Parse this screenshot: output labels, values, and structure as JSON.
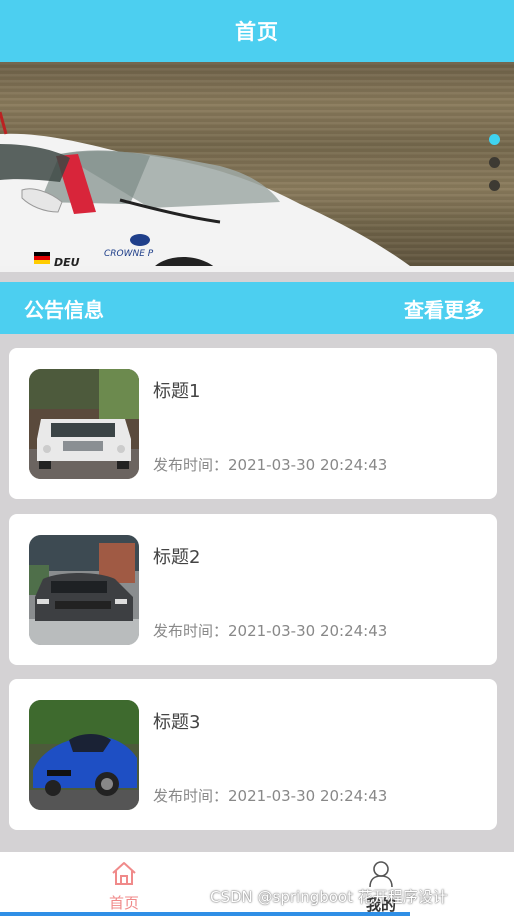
{
  "header": {
    "title": "首页"
  },
  "banner": {
    "slides_total": 3,
    "active_slide": 1
  },
  "notice": {
    "title": "公告信息",
    "more_label": "查看更多"
  },
  "items": [
    {
      "title": "标题1",
      "time": "发布时间：2021-03-30 20:24:43"
    },
    {
      "title": "标题2",
      "time": "发布时间：2021-03-30 20:24:43"
    },
    {
      "title": "标题3",
      "time": "发布时间：2021-03-30 20:24:43"
    }
  ],
  "tabbar": {
    "home_label": "首页",
    "mine_label": "我的"
  },
  "watermark": "CSDN @springboot 花开程序设计",
  "colors": {
    "primary": "#4ccff0",
    "active_tab": "#f08a8a",
    "background": "#d4d2d4"
  }
}
